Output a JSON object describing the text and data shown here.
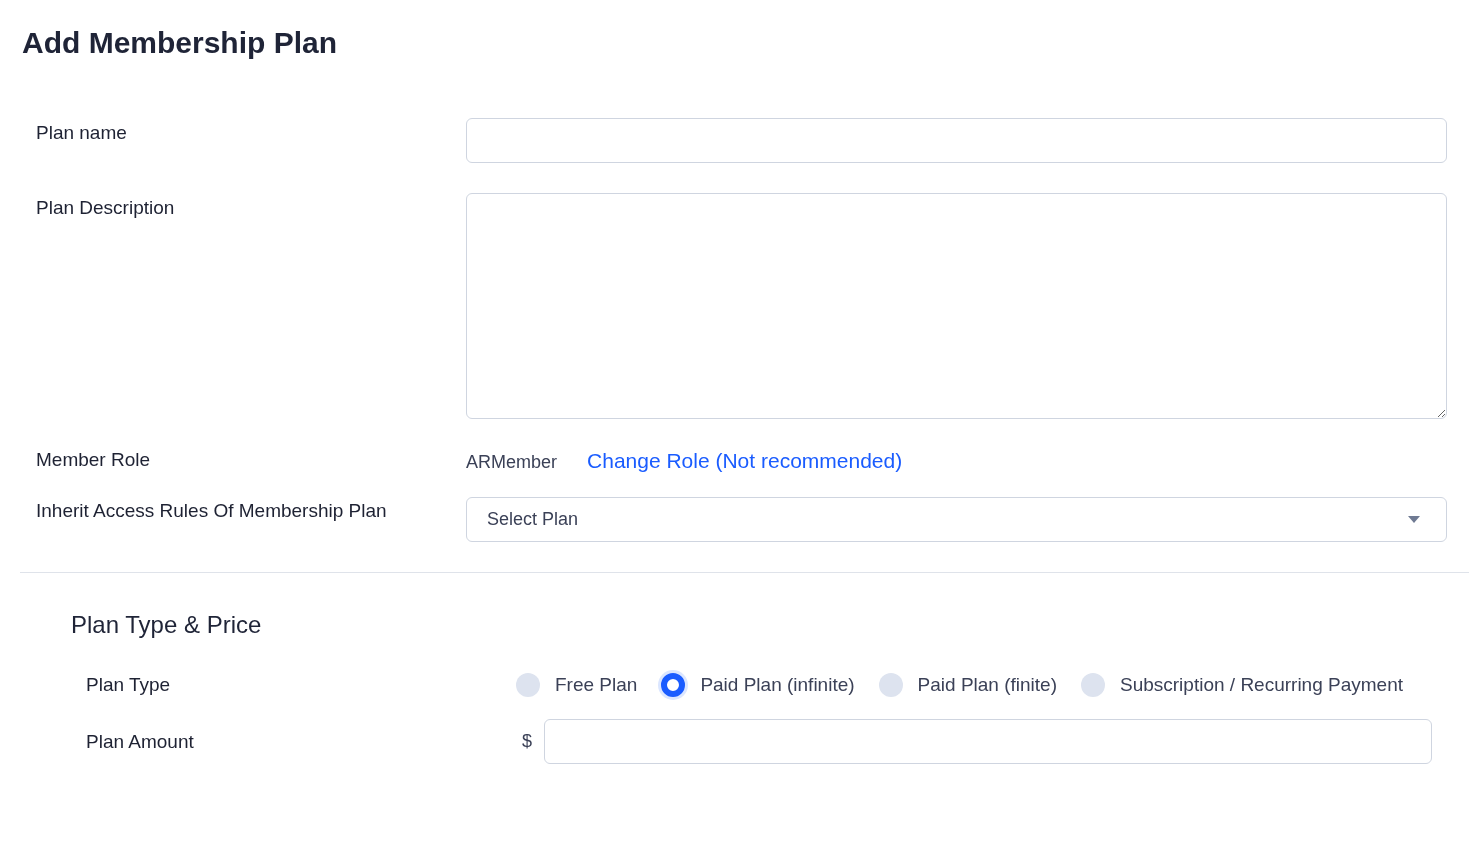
{
  "title": "Add Membership Plan",
  "fields": [
    {
      "kind": "text",
      "label": "Plan name"
    },
    {
      "kind": "textarea",
      "label": "Plan Description"
    },
    {
      "kind": "role",
      "label": "Member Role",
      "value": "ARMember",
      "link": "Change Role (Not recommended)"
    },
    {
      "kind": "select",
      "label": "Inherit Access Rules Of Membership Plan",
      "placeholder": "Select Plan"
    }
  ],
  "section": {
    "title": "Plan Type & Price",
    "plan_type": {
      "label": "Plan Type",
      "options": [
        {
          "label": "Free Plan",
          "selected": false
        },
        {
          "label": "Paid Plan (infinite)",
          "selected": true
        },
        {
          "label": "Paid Plan (finite)",
          "selected": false
        },
        {
          "label": "Subscription / Recurring Payment",
          "selected": false
        }
      ]
    },
    "plan_amount": {
      "label": "Plan Amount",
      "currency": "$"
    }
  }
}
